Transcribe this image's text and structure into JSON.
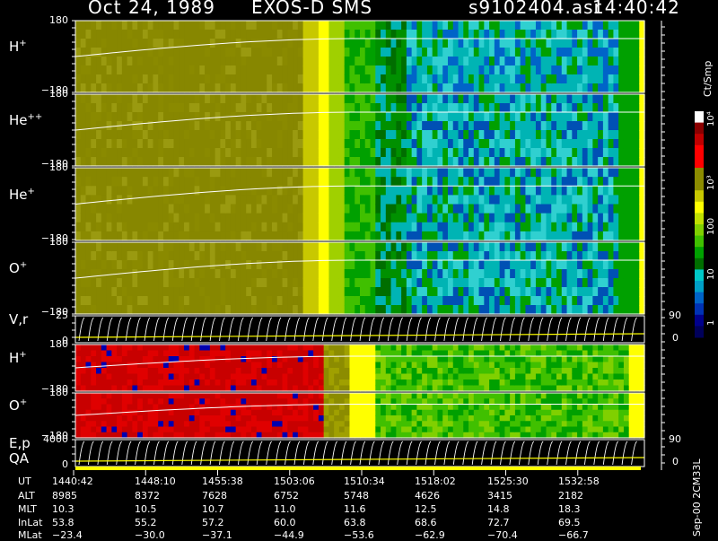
{
  "header": {
    "date": "Oct 24, 1989",
    "instrument": "EXOS-D SMS",
    "filename": "s9102404.asr",
    "time": "14:40:42"
  },
  "panels": [
    {
      "label_base": "H",
      "label_sup": "+",
      "ytop": "180",
      "ybot": "−180"
    },
    {
      "label_base": "He",
      "label_sup": "++",
      "ytop": "180",
      "ybot": "−180"
    },
    {
      "label_base": "He",
      "label_sup": "+",
      "ytop": "180",
      "ybot": "−180"
    },
    {
      "label_base": "O",
      "label_sup": "+",
      "ytop": "180",
      "ybot": "−180"
    },
    {
      "label_base": "V,r",
      "label_sup": "",
      "ytop": "25",
      "ybot": "0",
      "rtop": "90",
      "rbot": "0"
    },
    {
      "label_base": "H",
      "label_sup": "+",
      "ytop": "180",
      "ybot": "−180"
    },
    {
      "label_base": "O",
      "label_sup": "+",
      "ytop": "180",
      "ybot": "−180"
    },
    {
      "label_base": "E,p",
      "label_sup": "",
      "label2": "QA",
      "ytop": "4000",
      "ybot": "0",
      "rtop": "90",
      "rbot": "0"
    }
  ],
  "colorbar": {
    "units": "Ct/Smp",
    "ticks": [
      {
        "text": "10⁴",
        "pos": 0.02
      },
      {
        "text": "10³",
        "pos": 0.3
      },
      {
        "text": "100",
        "pos": 0.5
      },
      {
        "text": "10",
        "pos": 0.7
      },
      {
        "text": "1",
        "pos": 0.9
      }
    ]
  },
  "footer_note": "Sep-00  2CM33L",
  "ephemeris": {
    "labels": [
      "UT",
      "ALT",
      "MLT",
      "InLat",
      "MLat"
    ],
    "columns": [
      [
        "1440:42",
        "8985",
        "10.3",
        "53.8",
        "−23.4"
      ],
      [
        "1448:10",
        "8372",
        "10.5",
        "55.2",
        "−30.0"
      ],
      [
        "1455:38",
        "7628",
        "10.7",
        "57.2",
        "−37.1"
      ],
      [
        "1503:06",
        "6752",
        "11.0",
        "60.0",
        "−44.9"
      ],
      [
        "1510:34",
        "5748",
        "11.6",
        "63.8",
        "−53.6"
      ],
      [
        "1518:02",
        "4626",
        "12.5",
        "68.6",
        "−62.9"
      ],
      [
        "1525:30",
        "3415",
        "14.8",
        "72.7",
        "−70.4"
      ],
      [
        "1532:58",
        "2182",
        "18.3",
        "69.5",
        "−66.7"
      ]
    ]
  },
  "chart_data": {
    "type": "heatmap",
    "title": "Oct 24, 1989   EXOS-D SMS",
    "x_axis": "UT",
    "x_ticks": [
      "1440:42",
      "1448:10",
      "1455:38",
      "1503:06",
      "1510:34",
      "1518:02",
      "1525:30",
      "1532:58"
    ],
    "colorbar_label": "Ct/Smp",
    "colorbar_scale": "log",
    "colorbar_range": [
      1,
      10000
    ],
    "panels": [
      "H+",
      "He++",
      "He+",
      "O+",
      "V,r",
      "H+",
      "O+",
      "E,p QA"
    ],
    "colors": {
      "high": "#ff0000",
      "mid_high": "#8c8c00",
      "mid": "#ffff00",
      "low_mid": "#00a000",
      "low": "#00c8c8",
      "lowest": "#0000a0"
    }
  }
}
